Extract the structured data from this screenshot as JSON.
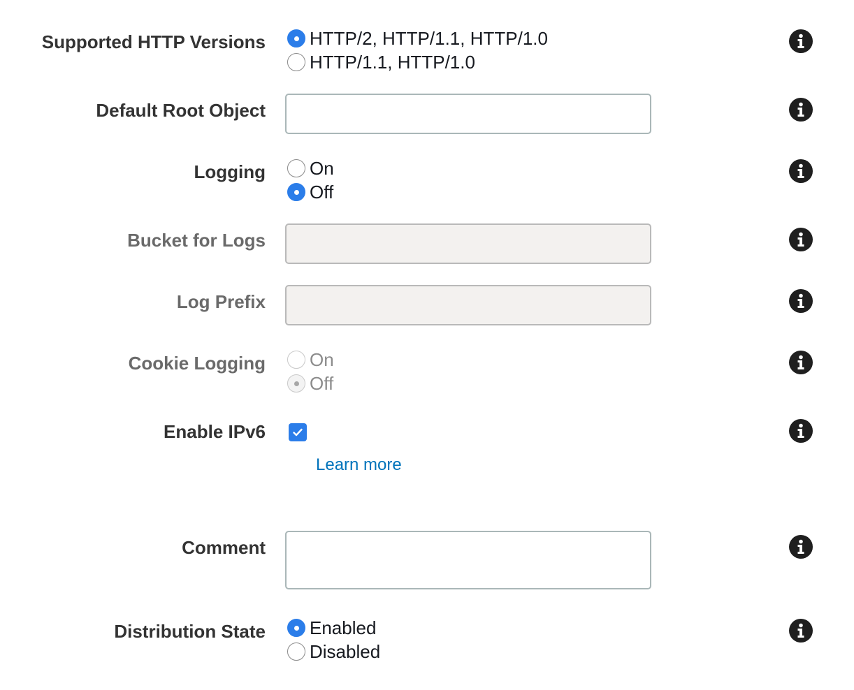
{
  "rows": {
    "http_versions": {
      "label": "Supported HTTP Versions",
      "options": [
        "HTTP/2, HTTP/1.1, HTTP/1.0",
        "HTTP/1.1, HTTP/1.0"
      ],
      "selected": "HTTP/2, HTTP/1.1, HTTP/1.0"
    },
    "default_root_object": {
      "label": "Default Root Object",
      "value": ""
    },
    "logging": {
      "label": "Logging",
      "options": [
        "On",
        "Off"
      ],
      "selected": "Off"
    },
    "bucket_for_logs": {
      "label": "Bucket for Logs",
      "value": "",
      "disabled": true
    },
    "log_prefix": {
      "label": "Log Prefix",
      "value": "",
      "disabled": true
    },
    "cookie_logging": {
      "label": "Cookie Logging",
      "options": [
        "On",
        "Off"
      ],
      "selected": "Off",
      "disabled": true
    },
    "enable_ipv6": {
      "label": "Enable IPv6",
      "checked": true,
      "link_label": "Learn more"
    },
    "comment": {
      "label": "Comment",
      "value": ""
    },
    "distribution_state": {
      "label": "Distribution State",
      "options": [
        "Enabled",
        "Disabled"
      ],
      "selected": "Enabled"
    }
  },
  "icons": {
    "info": "info-icon",
    "checkmark": "checkmark-icon"
  },
  "colors": {
    "accent": "#2b7de9",
    "link": "#0073bb",
    "label": "#333333",
    "disabled_label": "#6a6a6a",
    "disabled_field_bg": "#f3f1ef",
    "info_icon": "#1f1f1f"
  }
}
